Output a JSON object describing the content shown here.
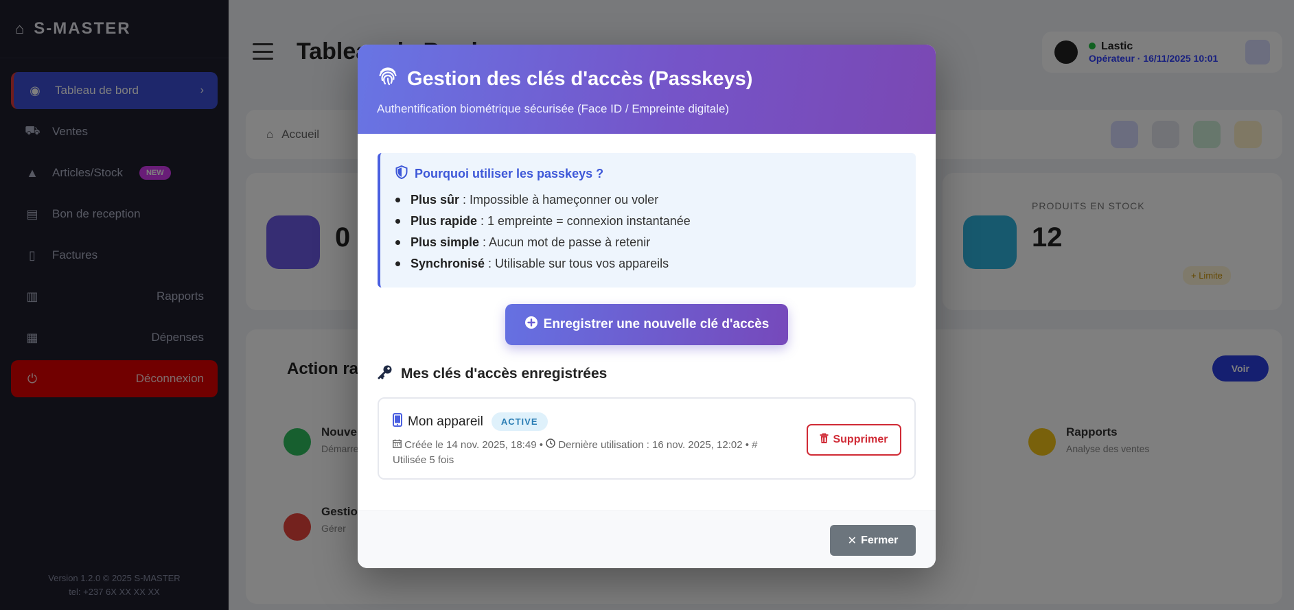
{
  "app": {
    "brand": "S-MASTER",
    "page_title": "Tableau de Bord",
    "breadcrumb": "Accueil",
    "user": {
      "name": "Lastic",
      "role": "Opérateur · 16/11/2025 10:01"
    },
    "sidebar": {
      "items": [
        {
          "label": "Tableau de bord"
        },
        {
          "label": "Ventes"
        },
        {
          "label": "Articles/Stock",
          "badge": "NEW"
        },
        {
          "label": "Bon de reception"
        },
        {
          "label": "Factures"
        },
        {
          "label": "Rapports"
        },
        {
          "label": "Dépenses"
        },
        {
          "label": "Déconnexion"
        }
      ],
      "footer_line1": "Version 1.2.0 © 2025 S-MASTER",
      "footer_line2": "tel: +237 6X XX XX XX"
    },
    "stats": [
      {
        "value": "0"
      },
      {
        "label": "PRODUITS EN STOCK",
        "value": "12",
        "badge": "+ Limite"
      }
    ],
    "actions": {
      "title": "Action rapides",
      "button": "Voir",
      "items": [
        {
          "name": "Nouvelle vente",
          "sub": "Démarrer"
        },
        {
          "name": "Rapports",
          "sub": "Analyse des ventes"
        },
        {
          "name": "Gestion",
          "sub": "Gérer"
        }
      ]
    }
  },
  "modal": {
    "title": "Gestion des clés d'accès (Passkeys)",
    "subtitle": "Authentification biométrique sécurisée (Face ID / Empreinte digitale)",
    "info": {
      "title": "Pourquoi utiliser les passkeys ?",
      "items": [
        {
          "strong": "Plus sûr",
          "text": ": Impossible à hameçonner ou voler"
        },
        {
          "strong": "Plus rapide",
          "text": ": 1 empreinte = connexion instantanée"
        },
        {
          "strong": "Plus simple",
          "text": ": Aucun mot de passe à retenir"
        },
        {
          "strong": "Synchronisé",
          "text": ": Utilisable sur tous vos appareils"
        }
      ]
    },
    "register_button": "Enregistrer une nouvelle clé d'accès",
    "keys_title": "Mes clés d'accès enregistrées",
    "key": {
      "name": "Mon appareil",
      "status": "ACTIVE",
      "created": "Créée le 14 nov. 2025, 18:49",
      "last_used": "Dernière utilisation : 16 nov. 2025, 12:02",
      "uses": "Utilisée 5 fois",
      "delete_label": "Supprimer"
    },
    "close_label": "Fermer"
  },
  "colors": {
    "header_gradient_start": "#6875e4",
    "header_gradient_end": "#7a48b3",
    "accent": "#3e58d8",
    "danger": "#d02a35",
    "close_button": "#6c757d"
  }
}
